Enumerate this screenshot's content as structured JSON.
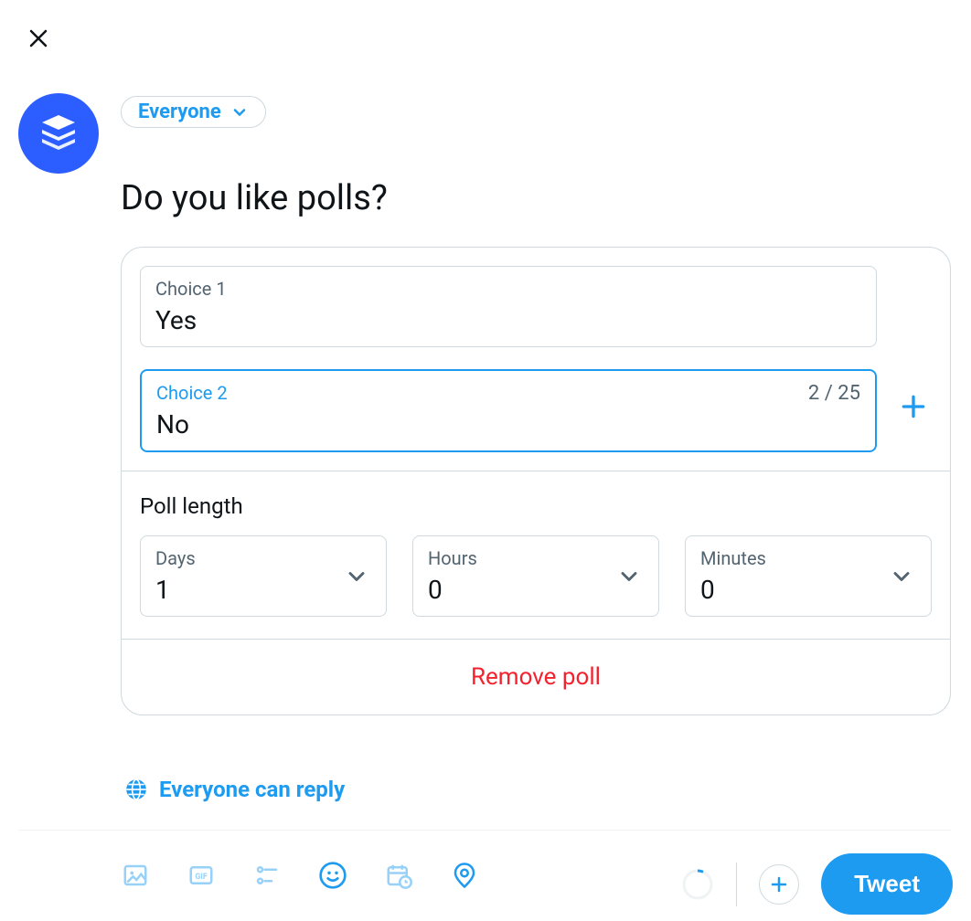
{
  "audience": {
    "label": "Everyone"
  },
  "tweet_text": "Do you like polls?",
  "poll": {
    "choices": [
      {
        "label": "Choice 1",
        "value": "Yes",
        "counter": "",
        "active": false
      },
      {
        "label": "Choice 2",
        "value": "No",
        "counter": "2 / 25",
        "active": true
      }
    ],
    "length_title": "Poll length",
    "duration": {
      "days": {
        "label": "Days",
        "value": "1"
      },
      "hours": {
        "label": "Hours",
        "value": "0"
      },
      "minutes": {
        "label": "Minutes",
        "value": "0"
      }
    },
    "remove_label": "Remove poll"
  },
  "reply_settings": {
    "label": "Everyone can reply"
  },
  "actions": {
    "tweet_label": "Tweet"
  }
}
